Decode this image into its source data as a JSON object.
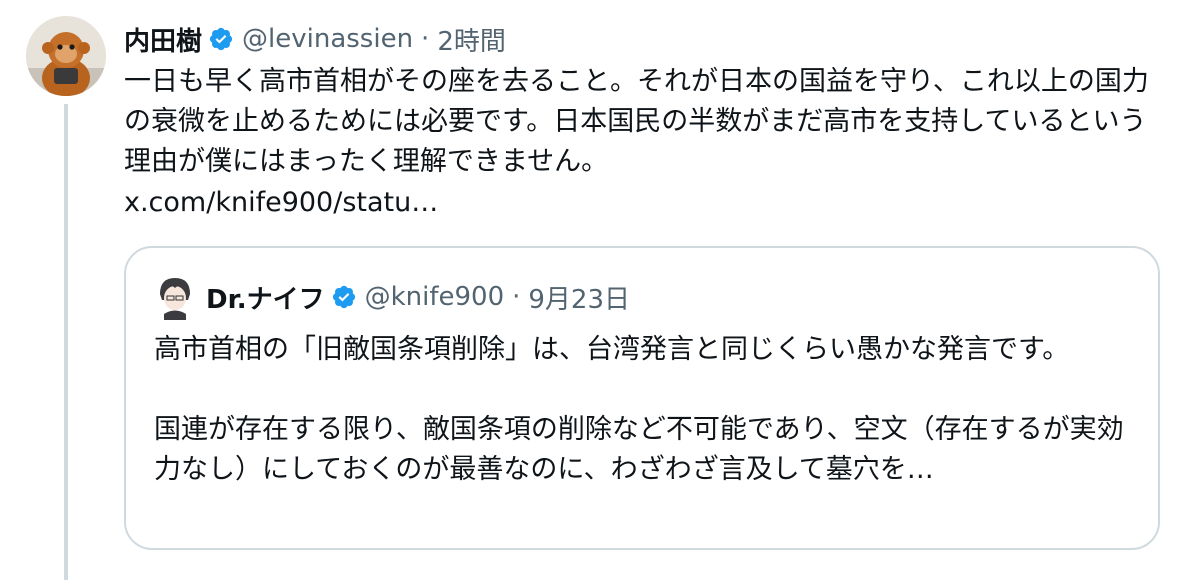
{
  "tweet": {
    "author": {
      "name": "内田樹",
      "handle": "@levinassien",
      "avatar": "orangutan-plush-avatar"
    },
    "separator": "·",
    "time": "2時間",
    "text": "一日も早く高市首相がその座を去ること。それが日本の国益を守り、これ以上の国力の衰微を止めるためには必要です。日本国民の半数がまだ高市を支持しているという理由が僕にはまったく理解できません。",
    "link": "x.com/knife900/statu…"
  },
  "quote": {
    "author": {
      "name": "Dr.ナイフ",
      "handle": "@knife900",
      "avatar": "anime-character-avatar"
    },
    "separator": "·",
    "date": "9月23日",
    "text": "高市首相の「旧敵国条項削除」は、台湾発言と同じくらい愚かな発言です。\n\n国連が存在する限り、敵国条項の削除など不可能であり、空文（存在するが実効力なし）にしておくのが最善なのに、わざわざ言及して墓穴を…"
  },
  "colors": {
    "verified": "#1d9bf0",
    "secondary_text": "#536471",
    "border": "#cfd9de",
    "primary_text": "#0f1419"
  }
}
